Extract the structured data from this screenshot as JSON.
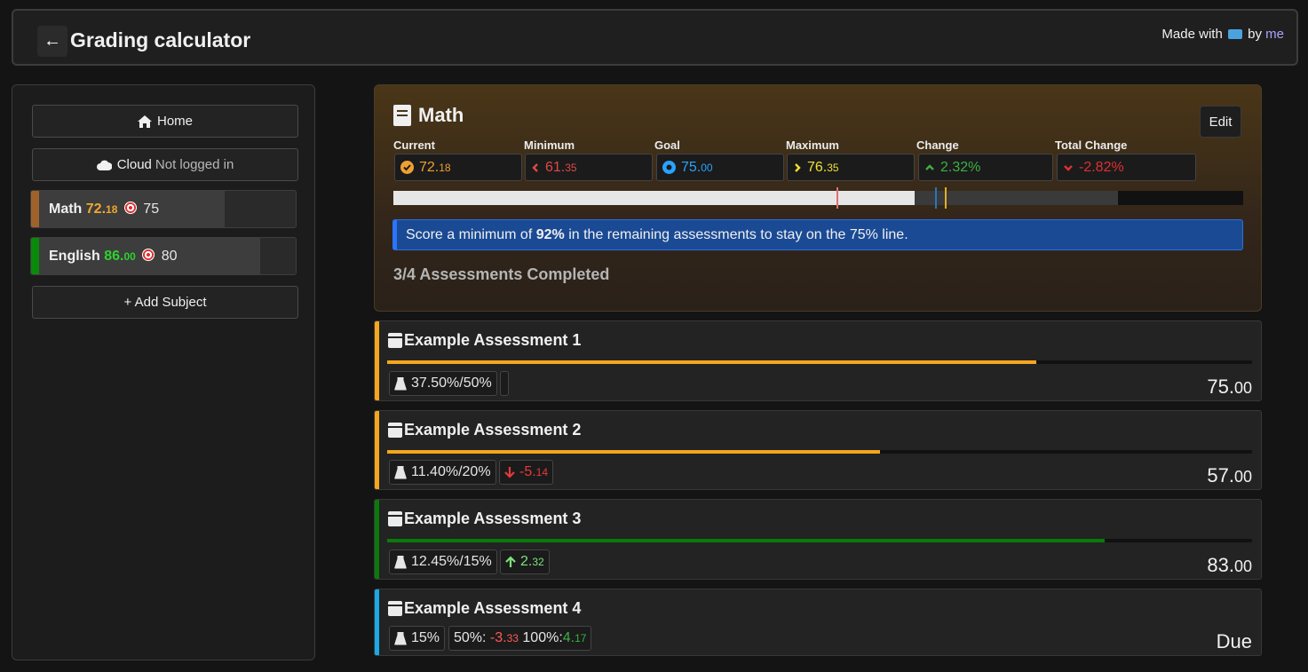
{
  "header": {
    "back_label": "←",
    "title": "Grading calculator",
    "made_with_prefix": "Made with",
    "made_with_by": "by",
    "made_with_link": "me"
  },
  "sidebar": {
    "home_label": "Home",
    "cloud_label": "Cloud",
    "cloud_status": "Not logged in",
    "subjects": [
      {
        "name": "Math",
        "grade_int": "72.",
        "grade_dec": "18",
        "target": "75",
        "color": "#a0622c",
        "grade_color": "#f0a830",
        "fill_fraction": 0.7218
      },
      {
        "name": "English",
        "grade_int": "86.",
        "grade_dec": "00",
        "target": "80",
        "color": "#0a8a0a",
        "grade_color": "#2ed12e",
        "fill_fraction": 0.86
      }
    ],
    "add_subject_label": "+ Add Subject"
  },
  "subject": {
    "title": "Math",
    "edit_label": "Edit",
    "stats": {
      "current": {
        "label": "Current",
        "int": "72.",
        "dec": "18",
        "color": "#f0a030"
      },
      "minimum": {
        "label": "Minimum",
        "int": "61.",
        "dec": "35",
        "color": "#e04848"
      },
      "goal": {
        "label": "Goal",
        "int": "75.",
        "dec": "00",
        "color": "#2aa2ff"
      },
      "maximum": {
        "label": "Maximum",
        "int": "76.",
        "dec": "35",
        "color": "#f0e030"
      },
      "change": {
        "label": "Change",
        "value": "2.32%",
        "color": "#3cb043"
      },
      "total_change": {
        "label": "Total Change",
        "value": "-2.82%",
        "color": "#e03030"
      }
    },
    "progress": {
      "minimum": 0.6135,
      "current": 0.7218,
      "goal": 0.75,
      "maximum": 0.7635,
      "possible_max": 0.853
    },
    "info": {
      "prefix": "Score a minimum of",
      "value": "92%",
      "suffix": "in the remaining assessments to stay on the 75% line."
    },
    "completed": "3/4 Assessments Completed"
  },
  "assessments": [
    {
      "name": "Example Assessment 1",
      "color": "#f4a61d",
      "bar_color": "#f4a61d",
      "fill_fraction": 0.75,
      "weight": "37.50%/50%",
      "change": "",
      "change_dir": "none",
      "score_int": "75.",
      "score_dec": "00"
    },
    {
      "name": "Example Assessment 2",
      "color": "#f4a61d",
      "bar_color": "#f4a61d",
      "fill_fraction": 0.57,
      "weight": "11.40%/20%",
      "change": "-5.",
      "change_dec": "14",
      "change_dir": "down",
      "score_int": "57.",
      "score_dec": "00"
    },
    {
      "name": "Example Assessment 3",
      "color": "#0a7a0a",
      "bar_color": "#0a7a0a",
      "fill_fraction": 0.83,
      "weight": "12.45%/15%",
      "change": "2.",
      "change_dec": "32",
      "change_dir": "up",
      "score_int": "83.",
      "score_dec": "00"
    },
    {
      "name": "Example Assessment 4",
      "color": "#1aa8e8",
      "weight": "15%",
      "due_label": "Due",
      "scenario": {
        "low_label": "50%:",
        "low_int": "-3.",
        "low_dec": "33",
        "high_label": "100%:",
        "high_int": "4.",
        "high_dec": "17"
      }
    }
  ]
}
